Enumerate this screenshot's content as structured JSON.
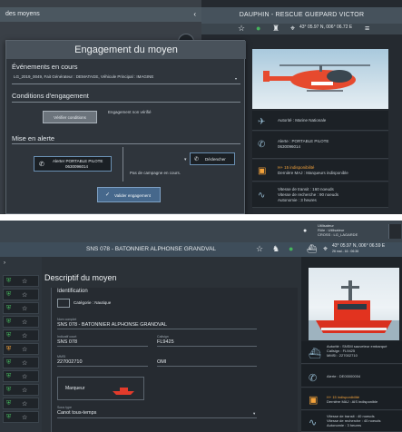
{
  "pane1": {
    "topbar_text": "des moyens",
    "right_title": "DAUPHIN - RESCUE GUEPARD VICTOR",
    "coords": "43° 05.97 N, 006° 06.72 E",
    "dialog": {
      "title": "Engagement du moyen",
      "section_events": "Événements en cours",
      "event_value": "LG_2019_0049, Fait Générateur : DEMATAGE, Véhicule Principal : IMAGINE",
      "section_conditions": "Conditions d'engagement",
      "verify_button": "Vérifier conditions",
      "verify_status": "Engagement non vérifié",
      "section_alert": "Mise en alerte",
      "alert_button_line1": "Alerter PORTABLE PILOTE",
      "alert_button_line2": "0630096014",
      "campaign_text": "Pas de campagne en cours.",
      "trigger_button": "Déclencher",
      "validate_button": "Valider engagement"
    },
    "info": [
      {
        "icon": "helicopter-icon",
        "lines": [
          "Autorité : Marine Nationale"
        ]
      },
      {
        "icon": "phone-icon",
        "lines": [
          "Alerte : PORTABLE PILOTE",
          "0630096014"
        ]
      },
      {
        "icon": "availability-icon",
        "lines": [
          "H+ 15 indisponibilité",
          "Dernière MAJ : Marqueurs indisponible"
        ]
      },
      {
        "icon": "chart-line-icon",
        "lines": [
          "Vitesse de transit : 160 noeuds",
          "Vitesse de recherche : 90 noeuds",
          "Autonomie : 3 heures"
        ]
      }
    ]
  },
  "pane2": {
    "top_right_lines": [
      "Utilisateur",
      "Rôle : Utilisateur",
      "CROSS : LG_LAGARDE"
    ],
    "bar_title": "SNS 078 - BATONNIER ALPHONSE GRANDVAL",
    "coords": "43° 05.97 N, 006° 06.59 E",
    "coords_sub": "26 mai - 16 : 06:36",
    "main_heading": "Descriptif du moyen",
    "identification": "Identification",
    "category": "Catégorie : Nautique",
    "fields": {
      "nom_label": "Nom complet",
      "nom_value": "SNS 078 - BATONNIER ALPHONSE GRANDVAL",
      "indicatif_label": "Indicatif court",
      "indicatif_value": "SNS 078",
      "callsign_label": "Callsign",
      "callsign_value": "FL9425",
      "mmsi_label": "MMSI",
      "mmsi_value": "227002710",
      "aisdsc_value": "OMI",
      "marqueur_label": "Marqueur",
      "soustype_label": "Sous type",
      "soustype_value": "Canot tous-temps"
    },
    "info": [
      {
        "icon": "boat-icon",
        "lines": [
          "Autorité : SNSM sauveteur embarqué",
          "Callsign : FL9425",
          "MMSI : 227002710"
        ]
      },
      {
        "icon": "phone-icon",
        "lines": [
          "Alerte : DE00000004"
        ]
      },
      {
        "icon": "availability-icon",
        "lines": [
          "H+ 15 indisponibilité",
          "Dernière MAJ : AIS indisponible"
        ]
      },
      {
        "icon": "chart-line-icon",
        "lines": [
          "Vitesse de transit : 40 noeuds",
          "Vitesse de recherche : 40 noeuds",
          "Autonomie : 3 heures"
        ]
      }
    ]
  },
  "colors": {
    "accent_blue": "#46688c",
    "status_green": "#45b45c",
    "warning_orange": "#f3a23a"
  }
}
